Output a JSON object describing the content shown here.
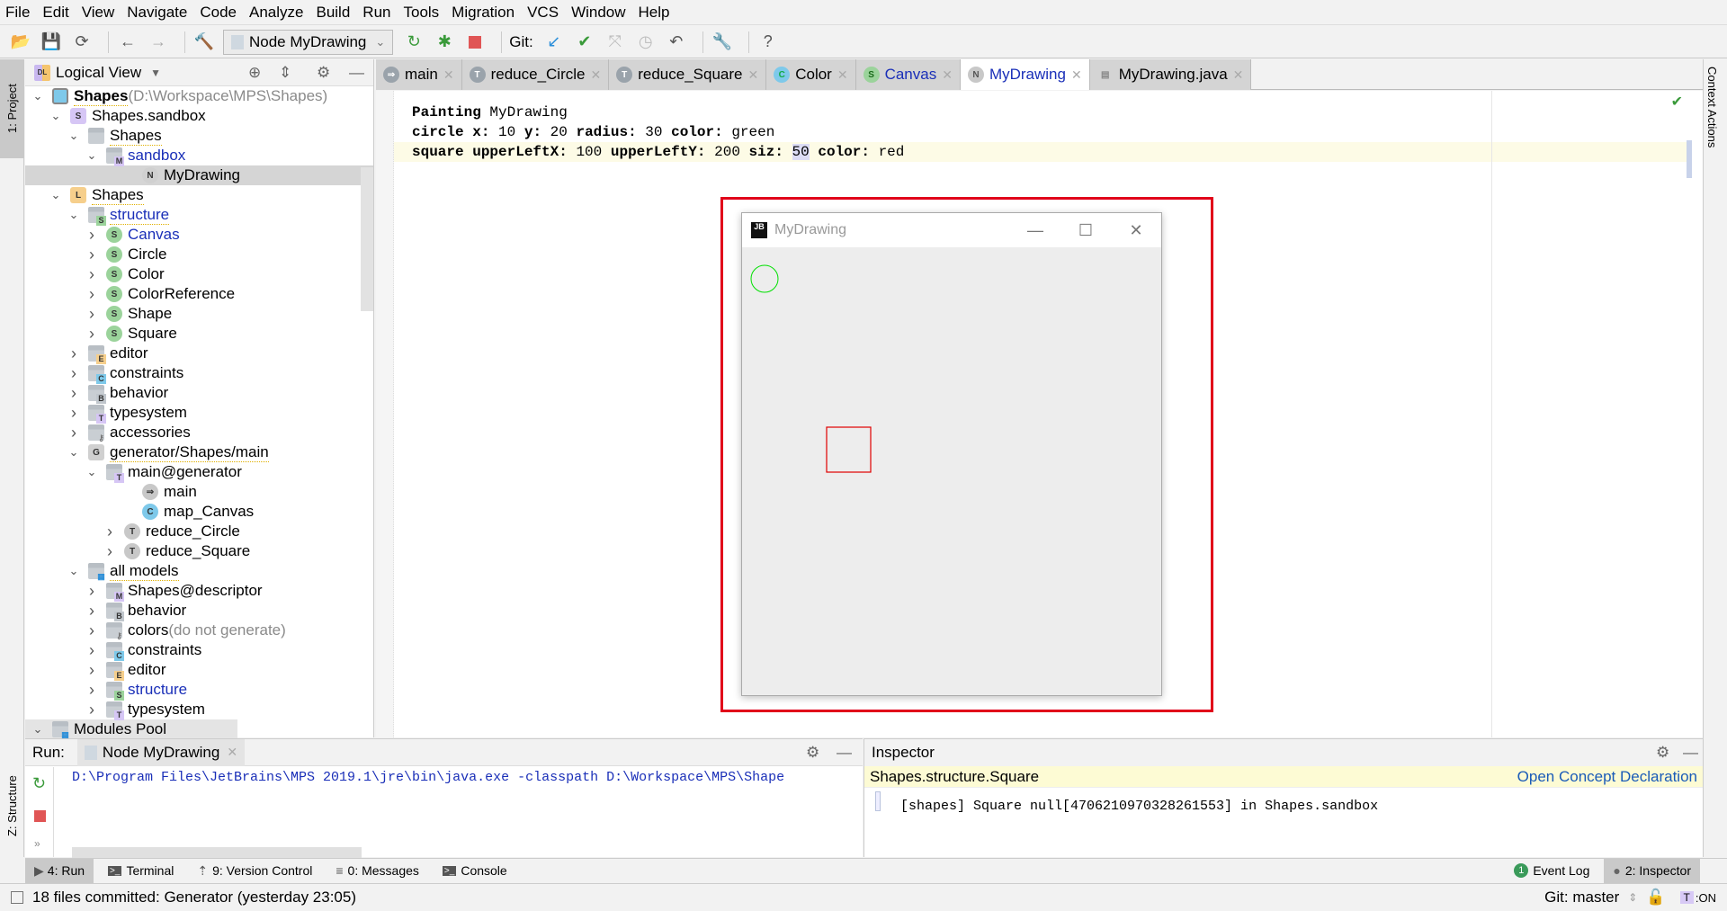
{
  "menu": [
    "File",
    "Edit",
    "View",
    "Navigate",
    "Code",
    "Analyze",
    "Build",
    "Run",
    "Tools",
    "Migration",
    "VCS",
    "Window",
    "Help"
  ],
  "toolbar": {
    "run_config": "Node MyDrawing",
    "git_label": "Git:"
  },
  "left_stripe": {
    "project_tab": "1: Project",
    "structure_tab": "Z: Structure"
  },
  "right_stripe": {
    "context_tab": "Context Actions"
  },
  "project": {
    "view_label": "Logical View",
    "tree": [
      {
        "label": "Shapes",
        "suffix": " (D:\\Workspace\\MPS\\Shapes)",
        "level": 0,
        "icon": "project",
        "expanded": true,
        "bold": true
      },
      {
        "label": "Shapes.sandbox",
        "level": 1,
        "icon": "S-solution",
        "expanded": true
      },
      {
        "label": "Shapes",
        "level": 2,
        "icon": "folder",
        "expanded": true
      },
      {
        "label": "sandbox",
        "level": 3,
        "icon": "M-model",
        "expanded": true,
        "blue": true
      },
      {
        "label": "MyDrawing",
        "level": 5,
        "icon": "N-node",
        "selected": true
      },
      {
        "label": "Shapes",
        "level": 1,
        "icon": "L-language",
        "expanded": true
      },
      {
        "label": "structure",
        "level": 2,
        "icon": "S-model",
        "expanded": true,
        "blue": true
      },
      {
        "label": "Canvas",
        "level": 3,
        "icon": "S-concept",
        "collapsed": true,
        "blue": true
      },
      {
        "label": "Circle",
        "level": 3,
        "icon": "S-concept",
        "collapsed": true
      },
      {
        "label": "Color",
        "level": 3,
        "icon": "S-concept",
        "collapsed": true
      },
      {
        "label": "ColorReference",
        "level": 3,
        "icon": "S-concept",
        "collapsed": true
      },
      {
        "label": "Shape",
        "level": 3,
        "icon": "S-concept",
        "collapsed": true
      },
      {
        "label": "Square",
        "level": 3,
        "icon": "S-concept",
        "collapsed": true
      },
      {
        "label": "editor",
        "level": 2,
        "icon": "E-model",
        "collapsed": true
      },
      {
        "label": "constraints",
        "level": 2,
        "icon": "C-model",
        "collapsed": true
      },
      {
        "label": "behavior",
        "level": 2,
        "icon": "B-model",
        "collapsed": true
      },
      {
        "label": "typesystem",
        "level": 2,
        "icon": "T-model",
        "collapsed": true
      },
      {
        "label": "accessories",
        "level": 2,
        "icon": "key-model",
        "collapsed": true
      },
      {
        "label": "generator/Shapes/main",
        "level": 2,
        "icon": "G-generator",
        "expanded": true
      },
      {
        "label": "main@generator",
        "level": 3,
        "icon": "T-model",
        "expanded": true
      },
      {
        "label": "main",
        "level": 5,
        "icon": "arrow-node"
      },
      {
        "label": "map_Canvas",
        "level": 5,
        "icon": "C-node"
      },
      {
        "label": "reduce_Circle",
        "level": 4,
        "icon": "T-node",
        "collapsed": true
      },
      {
        "label": "reduce_Square",
        "level": 4,
        "icon": "T-node",
        "collapsed": true
      },
      {
        "label": "all models",
        "level": 2,
        "icon": "models",
        "expanded": true
      },
      {
        "label": "Shapes@descriptor",
        "level": 3,
        "icon": "M-model",
        "collapsed": true
      },
      {
        "label": "behavior",
        "level": 3,
        "icon": "B-model",
        "collapsed": true
      },
      {
        "label": "colors",
        "suffix": " (do not generate)",
        "level": 3,
        "icon": "key-model",
        "collapsed": true
      },
      {
        "label": "constraints",
        "level": 3,
        "icon": "C-model",
        "collapsed": true
      },
      {
        "label": "editor",
        "level": 3,
        "icon": "E-model",
        "collapsed": true
      },
      {
        "label": "structure",
        "level": 3,
        "icon": "S-model",
        "collapsed": true,
        "blue": true
      },
      {
        "label": "typesystem",
        "level": 3,
        "icon": "T-model",
        "collapsed": true
      },
      {
        "label": "Modules Pool",
        "level": 0,
        "icon": "models",
        "expanded": true
      }
    ]
  },
  "tabs": [
    {
      "label": "main",
      "icon": "arrow"
    },
    {
      "label": "reduce_Circle",
      "icon": "T"
    },
    {
      "label": "reduce_Square",
      "icon": "T"
    },
    {
      "label": "Color",
      "icon": "C"
    },
    {
      "label": "Canvas",
      "icon": "S"
    },
    {
      "label": "MyDrawing",
      "icon": "N",
      "active": true
    },
    {
      "label": "MyDrawing.java",
      "icon": "file"
    }
  ],
  "editor": {
    "line1": {
      "kw": "Painting",
      "name": "MyDrawing"
    },
    "line2": {
      "kw": "circle",
      "x_label": "x:",
      "x": "10",
      "y_label": "y:",
      "y": "20",
      "r_label": "radius:",
      "r": "30",
      "c_label": "color:",
      "c": "green"
    },
    "line3": {
      "kw": "square",
      "ux_label": "upperLeftX:",
      "ux": "100",
      "uy_label": "upperLeftY:",
      "uy": "200",
      "s_label": "siz:",
      "s": "50",
      "c_label": "color:",
      "c": "red"
    }
  },
  "drawing_window": {
    "title": "MyDrawing",
    "logo": "JB",
    "circle_color": "#00e000",
    "square_color": "#e00000",
    "frame_color": "#e1001a"
  },
  "run": {
    "label": "Run:",
    "tab": "Node MyDrawing",
    "output": "D:\\Program Files\\JetBrains\\MPS 2019.1\\jre\\bin\\java.exe -classpath D:\\Workspace\\MPS\\Shape"
  },
  "inspector": {
    "title": "Inspector",
    "concept": "Shapes.structure.Square",
    "open_link": "Open Concept Declaration",
    "content": "[shapes] Square null[4706210970328261553] in Shapes.sandbox"
  },
  "toolwindows": {
    "run": "4: Run",
    "terminal": "Terminal",
    "vcs": "9: Version Control",
    "messages": "0: Messages",
    "console": "Console",
    "event_log": "Event Log",
    "event_log_count": "1",
    "inspector": "2: Inspector"
  },
  "status": {
    "message": "18 files committed: Generator (yesterday 23:05)",
    "git_branch": "Git: master",
    "t_badge": "T",
    "t_state": ":ON"
  }
}
